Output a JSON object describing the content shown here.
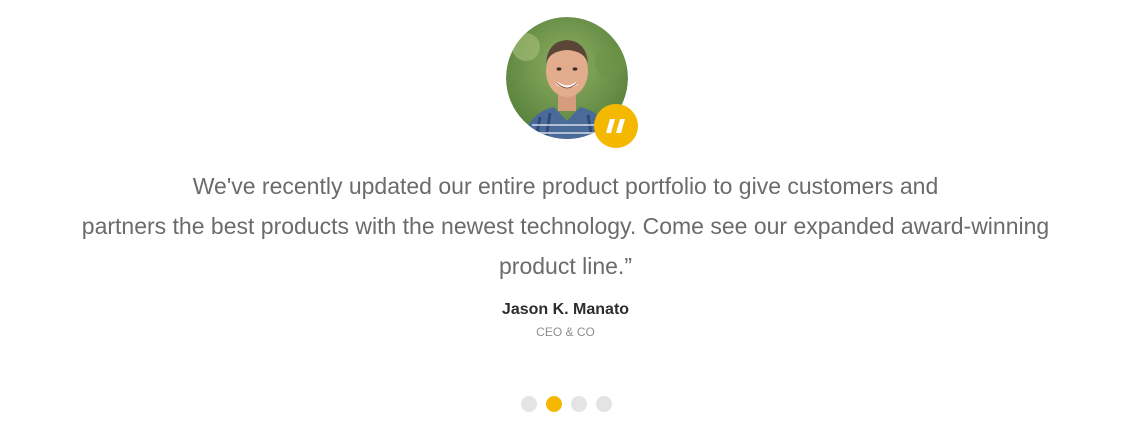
{
  "testimonial": {
    "quote_lines": [
      "We've recently updated our entire product portfolio to give customers and",
      "partners the best products with the newest technology. Come see our expanded award-winning",
      "product line.”"
    ],
    "author_name": "Jason K. Manato",
    "author_role": "CEO & CO"
  },
  "badge": {
    "icon": "quote-icon"
  },
  "colors": {
    "accent": "#f5b800",
    "dot_inactive": "#e4e4e4",
    "text": "#6b6b6b"
  },
  "pagination": {
    "dot_count": 4,
    "active_index": 1
  }
}
